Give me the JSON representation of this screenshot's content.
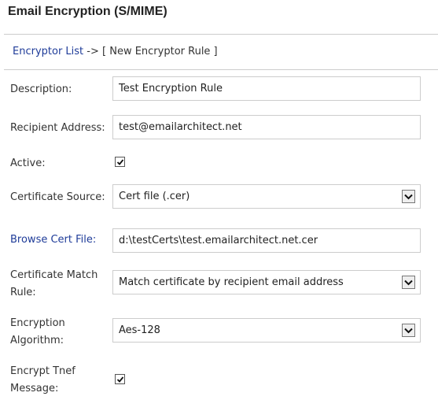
{
  "header": {
    "title": "Email Encryption (S/MIME)"
  },
  "breadcrumb": {
    "link": "Encryptor List",
    "separator": " -> ",
    "current": "[ New Encryptor Rule ]"
  },
  "form": {
    "description": {
      "label": "Description:",
      "value": "Test Encryption Rule"
    },
    "recipient": {
      "label": "Recipient Address:",
      "value": "test@emailarchitect.net"
    },
    "active": {
      "label": "Active:",
      "checked": true
    },
    "cert_source": {
      "label": "Certificate Source:",
      "value": "Cert file (.cer)"
    },
    "browse_cert": {
      "label": "Browse Cert File:",
      "value": "d:\\testCerts\\test.emailarchitect.net.cer"
    },
    "match_rule": {
      "label_line1": "Certificate Match",
      "label_line2": "Rule:",
      "value": "Match certificate by recipient email address"
    },
    "algorithm": {
      "label_line1": "Encryption",
      "label_line2": "Algorithm:",
      "value": "Aes-128"
    },
    "encrypt_tnef": {
      "label_line1": "Encrypt Tnef",
      "label_line2": "Message:",
      "checked": true
    }
  },
  "colors": {
    "link": "#1f3c99",
    "border": "#cccccc"
  }
}
